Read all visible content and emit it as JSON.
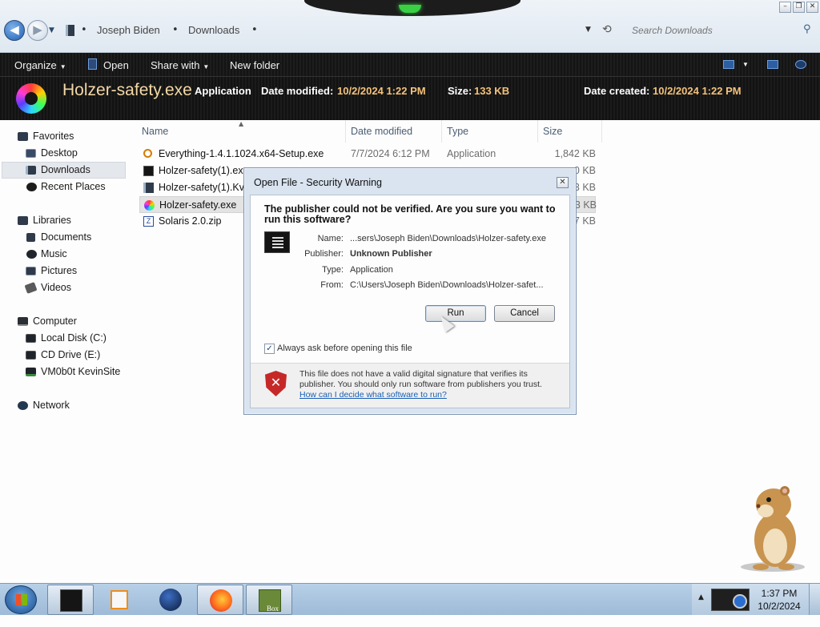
{
  "explorer": {
    "breadcrumb": [
      "Joseph Biden",
      "Downloads"
    ],
    "search_placeholder": "Search Downloads",
    "toolbar": {
      "organize": "Organize",
      "open": "Open",
      "share_with": "Share with",
      "new_folder": "New folder"
    },
    "details": {
      "filename": "Holzer-safety.exe",
      "type": "Application",
      "date_modified_label": "Date modified:",
      "date_modified": "10/2/2024 1:22 PM",
      "size_label": "Size:",
      "size": "133 KB",
      "date_created_label": "Date created:",
      "date_created": "10/2/2024 1:22 PM"
    },
    "nav": {
      "favorites": "Favorites",
      "desktop": "Desktop",
      "downloads": "Downloads",
      "recent_places": "Recent Places",
      "libraries": "Libraries",
      "documents": "Documents",
      "music": "Music",
      "pictures": "Pictures",
      "videos": "Videos",
      "computer": "Computer",
      "local_disk": "Local Disk (C:)",
      "cd_drive": "CD Drive (E:)",
      "network_share": "VM0b0t KevinSite",
      "network": "Network"
    },
    "columns": [
      "Name",
      "Date modified",
      "Type",
      "Size"
    ],
    "files": [
      {
        "name": "Everything-1.4.1.1024.x64-Setup.exe",
        "date": "7/7/2024 6:12 PM",
        "type": "Application",
        "size": "1,842 KB"
      },
      {
        "name": "Holzer-safety(1).exe",
        "date": "",
        "type": "",
        "size": "0 KB"
      },
      {
        "name": "Holzer-safety(1).KvJl",
        "date": "",
        "type": "",
        "size": "3 KB"
      },
      {
        "name": "Holzer-safety.exe",
        "date": "",
        "type": "",
        "size": "3 KB"
      },
      {
        "name": "Solaris 2.0.zip",
        "date": "",
        "type": "",
        "size": "7 KB"
      }
    ]
  },
  "dialog": {
    "title": "Open File - Security Warning",
    "question": "The publisher could not be verified.  Are you sure you want to run this software?",
    "name_label": "Name:",
    "name_value": "...sers\\Joseph Biden\\Downloads\\Holzer-safety.exe",
    "publisher_label": "Publisher:",
    "publisher_value": "Unknown Publisher",
    "type_label": "Type:",
    "type_value": "Application",
    "from_label": "From:",
    "from_value": "C:\\Users\\Joseph Biden\\Downloads\\Holzer-safet...",
    "run_label": "Run",
    "cancel_label": "Cancel",
    "always_ask_label": "Always ask before opening this file",
    "always_ask_checked": true,
    "warning_text": "This file does not have a valid digital signature that verifies its publisher.  You should only run software from publishers you trust.",
    "help_link": "How can I decide what software to run?"
  },
  "taskbar": {
    "time": "1:37 PM",
    "date": "10/2/2024",
    "apps": [
      "explorer-app",
      "media-player-app",
      "globe-app",
      "firefox-app",
      "box-app"
    ],
    "box_label": "Box"
  }
}
